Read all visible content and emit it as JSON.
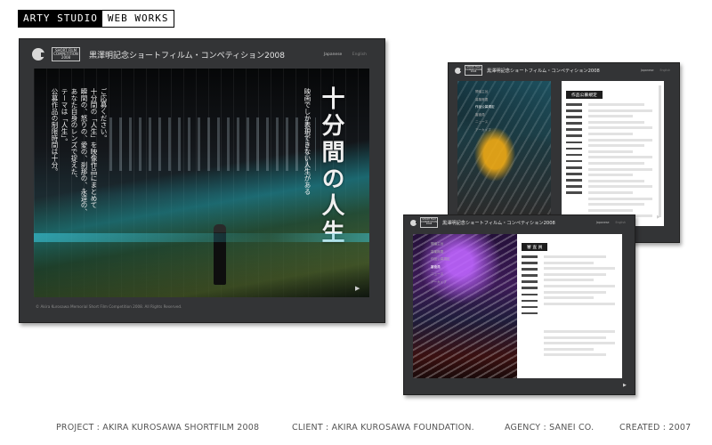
{
  "header": {
    "logo_part1": "ARTY STUDIO",
    "logo_part2": "WEB WORKS"
  },
  "site": {
    "title": "黒澤明記念ショートフィルム・コンペティション2008",
    "comp_logo_line1": "SHORT FILM",
    "comp_logo_line2": "COMPETITION",
    "comp_logo_line3": "2008",
    "lang_ja": "Japanese",
    "lang_en": "English",
    "copyright": "© Akira Kurosawa Memorial Short Film Competition 2008. All Rights Reserved.",
    "next_arrow": "▶"
  },
  "hero": {
    "headline": "十分間の人生",
    "tagline": "映画でしか表現できない人生がある",
    "poem": [
      "公募作品の制限時間は十分。",
      "テーマは「人生」。",
      "あなた自身のレンズで捉えた、",
      "瞬間の、怒りの、愛の、刹那の、永遠の、",
      "十分間の「人生」を映像作品にまとめて",
      "ご応募ください。"
    ]
  },
  "screen2": {
    "menu": [
      "開催主旨",
      "募集概要",
      "作品公募規定",
      "審査員",
      "ニュース",
      "アーカイブ"
    ],
    "active_index": 2,
    "doc_title": "作品公募規定"
  },
  "screen3": {
    "menu": [
      "開催主旨",
      "募集概要",
      "作品公募規定",
      "審査員",
      "ニュース",
      "アーカイブ"
    ],
    "active_index": 3,
    "doc_title": "審 査 員"
  },
  "footer": {
    "project": "PROJECT : AKIRA KUROSAWA SHORTFILM 2008",
    "client": "CLIENT : AKIRA KUROSAWA FOUNDATION.",
    "agency": "AGENCY : SANEI CO.",
    "created": "CREATED : 2007"
  }
}
